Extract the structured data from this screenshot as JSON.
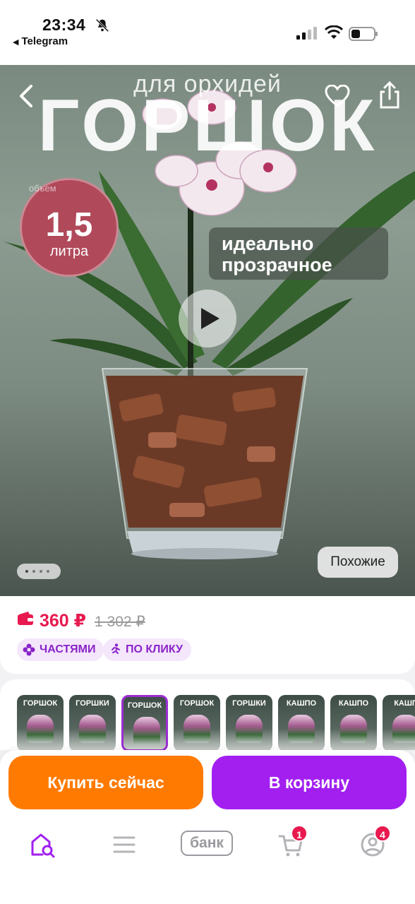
{
  "status_bar": {
    "time": "23:34",
    "back_app": "Telegram",
    "back_arrow": "◀"
  },
  "hero": {
    "subtitle": "для орхидей",
    "title": "ГОРШОК",
    "volume_ring": "объем",
    "volume_value": "1,5",
    "volume_unit": "литра",
    "feature_line1": "идеально",
    "feature_line2": "прозрачное",
    "similar_button": "Похожие",
    "slide_count": 4,
    "active_slide": 1
  },
  "price": {
    "current": "360 ₽",
    "old": "1 302 ₽",
    "chip_parts": "ЧАСТЯМИ",
    "chip_click": "ПО КЛИКУ"
  },
  "thumbnails": [
    {
      "title": "ГОРШОК"
    },
    {
      "title": "ГОРШКИ"
    },
    {
      "title": "ГОРШОК"
    },
    {
      "title": "ГОРШОК"
    },
    {
      "title": "ГОРШКИ"
    },
    {
      "title": "КАШПО"
    },
    {
      "title": "КАШПО"
    },
    {
      "title": "КАШП"
    }
  ],
  "selected_thumbnail": 2,
  "actions": {
    "buy_now": "Купить сейчас",
    "add_to_cart": "В корзину"
  },
  "nav": {
    "bank_label": "банк",
    "cart_badge": "1",
    "profile_badge": "4"
  },
  "colors": {
    "price_red": "#e8194f",
    "buy_orange": "#ff7a00",
    "cart_purple": "#a21ff0",
    "chip_text": "#8a23c9"
  }
}
